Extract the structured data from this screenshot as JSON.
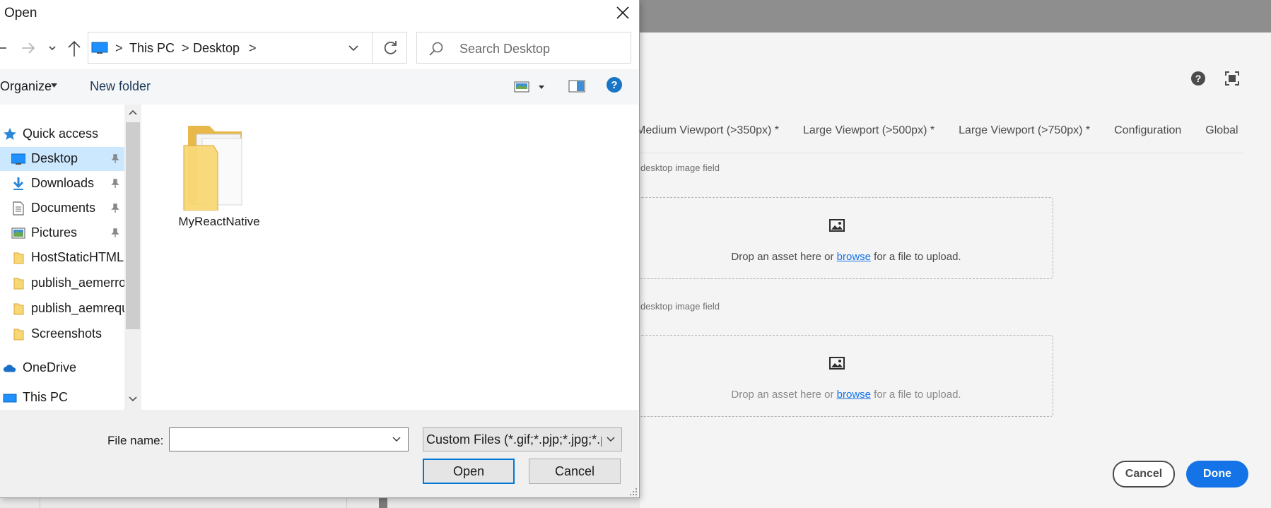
{
  "background": {
    "tabs": [
      "Medium Viewport (>350px) *",
      "Large Viewport (>500px) *",
      "Large Viewport (>750px) *",
      "Configuration",
      "Global"
    ],
    "field_label_1": "r desktop image field",
    "field_label_2": "r desktop image field",
    "dropzone_1": {
      "prefix": "Drop an asset here or ",
      "link": "browse",
      "suffix": " for a file to upload."
    },
    "dropzone_2": {
      "prefix": "Drop an asset here or ",
      "link": "browse",
      "suffix": " for a file to upload."
    },
    "cancel_label": "Cancel",
    "done_label": "Done",
    "icons": {
      "help": "help-circle-icon",
      "fullscreen": "fullscreen-icon",
      "image": "image-icon"
    },
    "colors": {
      "accent": "#1473e6",
      "panel": "#f4f4f4"
    }
  },
  "dialog": {
    "title": "Open",
    "address": {
      "crumbs": [
        "This PC",
        "Desktop"
      ]
    },
    "search_placeholder": "Search Desktop",
    "toolbar": {
      "organize_label": "Organize",
      "new_folder_label": "New folder"
    },
    "nav_items": [
      {
        "label": "Quick access",
        "icon": "star-icon",
        "pinned": false
      },
      {
        "label": "Desktop",
        "icon": "desktop-icon",
        "pinned": true,
        "selected": true
      },
      {
        "label": "Downloads",
        "icon": "download-icon",
        "pinned": true
      },
      {
        "label": "Documents",
        "icon": "document-icon",
        "pinned": true
      },
      {
        "label": "Pictures",
        "icon": "pictures-icon",
        "pinned": true
      },
      {
        "label": "HostStaticHTML",
        "icon": "folder-icon",
        "pinned": false
      },
      {
        "label": "publish_aemerrorpage",
        "icon": "folder-icon",
        "pinned": false
      },
      {
        "label": "publish_aemrequests",
        "icon": "folder-icon",
        "pinned": false
      },
      {
        "label": "Screenshots",
        "icon": "folder-icon",
        "pinned": false
      },
      {
        "label": "OneDrive",
        "icon": "cloud-icon",
        "pinned": false
      },
      {
        "label": "This PC",
        "icon": "pc-icon",
        "pinned": false
      }
    ],
    "files": [
      {
        "name": "MyReactNative",
        "icon": "folder-icon"
      }
    ],
    "file_name_label": "File name:",
    "file_name_value": "",
    "file_type_value": "Custom Files (*.gif;*.pjp;*.jpg;*.pjpeg;*.jpeg;*.jfif;*.png)",
    "open_label": "Open",
    "cancel_label": "Cancel",
    "colors": {
      "selection": "#cce8ff",
      "accent": "#0078d7",
      "folder": "#f8d775"
    }
  }
}
